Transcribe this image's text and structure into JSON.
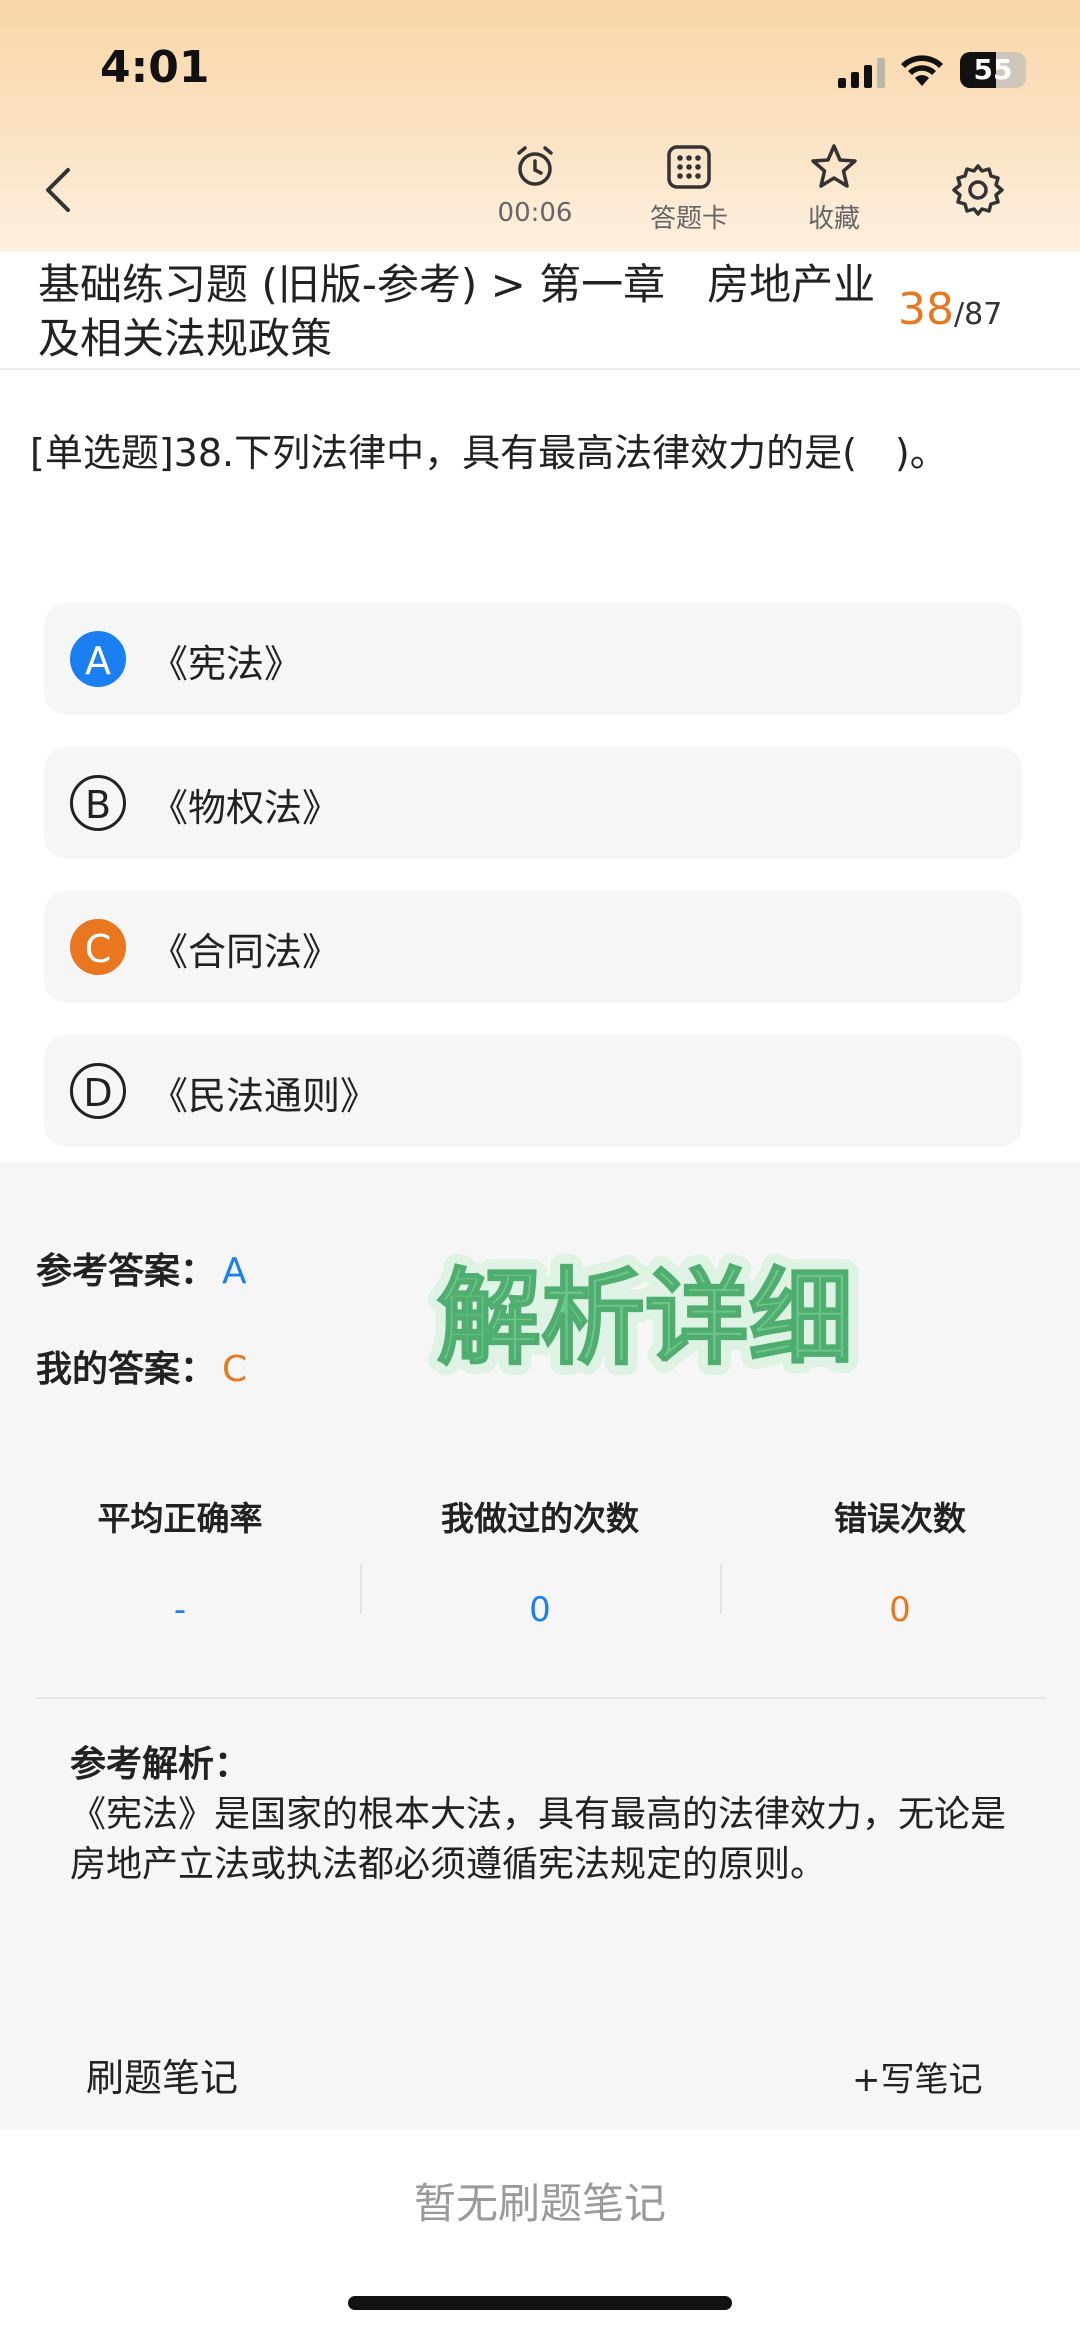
{
  "status": {
    "time": "4:01",
    "battery": "55",
    "battery_level": 0.55
  },
  "toolbar": {
    "timer": "00:06",
    "answer_card": "答题卡",
    "favorite": "收藏"
  },
  "breadcrumb": {
    "path": "基础练习题 (旧版-参考) > 第一章　房地产业及相关法规政策",
    "current": "38",
    "total": "/87"
  },
  "question": {
    "text": "[单选题]38.下列法律中，具有最高法律效力的是(　)。",
    "options": [
      {
        "letter": "A",
        "text": "《宪法》",
        "state": "correct"
      },
      {
        "letter": "B",
        "text": "《物权法》",
        "state": "none"
      },
      {
        "letter": "C",
        "text": "《合同法》",
        "state": "wrong"
      },
      {
        "letter": "D",
        "text": "《民法通则》",
        "state": "none"
      }
    ]
  },
  "answers": {
    "reference_label": "参考答案：",
    "reference_value": "A",
    "mine_label": "我的答案：",
    "mine_value": "C",
    "sticker": "解析详细"
  },
  "stats": [
    {
      "title": "平均正确率",
      "value": "-",
      "color": "#1a7ff0"
    },
    {
      "title": "我做过的次数",
      "value": "0",
      "color": "#1a7ff0"
    },
    {
      "title": "错误次数",
      "value": "0",
      "color": "#e8771f"
    }
  ],
  "analysis": {
    "head": "参考解析：",
    "body": "《宪法》是国家的根本大法，具有最高的法律效力，无论是房地产立法或执法都必须遵循宪法规定的原则。"
  },
  "notes": {
    "title": "刷题笔记",
    "write": "+写笔记",
    "empty": "暂无刷题笔记"
  },
  "colors": {
    "accent_blue": "#1a7ff0",
    "accent_orange": "#e8771f",
    "sticker_green": "#6cc58a"
  }
}
